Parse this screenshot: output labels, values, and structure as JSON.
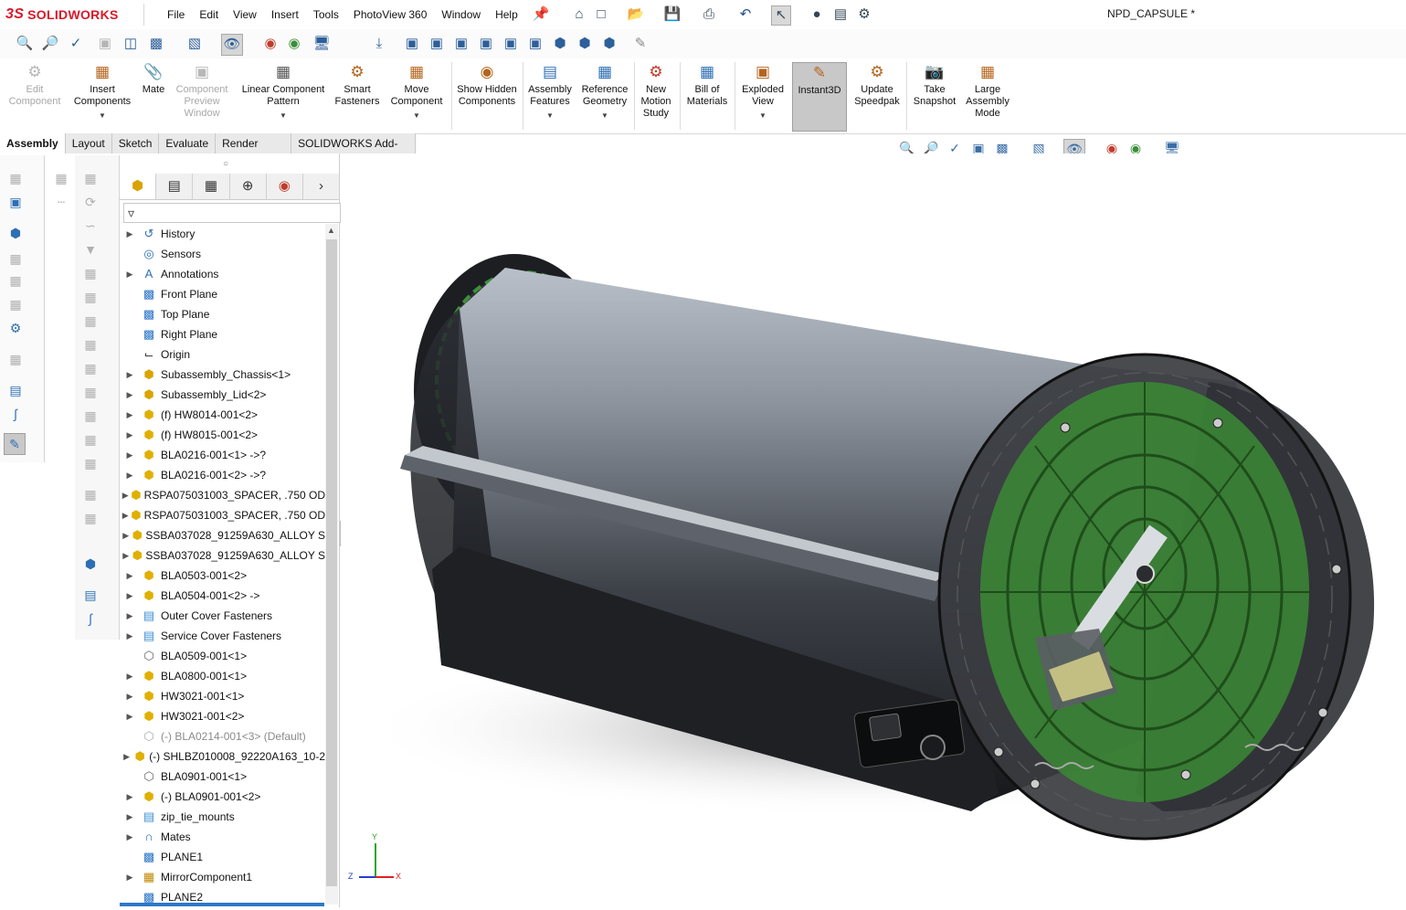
{
  "app": {
    "brand": "SOLIDWORKS",
    "brand_prefix": "3S",
    "document_title": "NPD_CAPSULE *"
  },
  "menu": [
    "File",
    "Edit",
    "View",
    "Insert",
    "Tools",
    "PhotoView 360",
    "Window",
    "Help"
  ],
  "command_manager": [
    {
      "label": "Edit Component",
      "icon": "edit-component-icon",
      "enabled": false
    },
    {
      "label": "Insert Components",
      "icon": "insert-components-icon",
      "enabled": true
    },
    {
      "label": "Mate",
      "icon": "mate-icon",
      "enabled": true
    },
    {
      "label": "Component Preview Window",
      "icon": "preview-window-icon",
      "enabled": false
    },
    {
      "label": "Linear Component Pattern",
      "icon": "linear-pattern-icon",
      "enabled": true
    },
    {
      "label": "Smart Fasteners",
      "icon": "smart-fasteners-icon",
      "enabled": true
    },
    {
      "label": "Move Component",
      "icon": "move-component-icon",
      "enabled": true
    },
    {
      "label": "Show Hidden Components",
      "icon": "show-hidden-icon",
      "enabled": true
    },
    {
      "label": "Assembly Features",
      "icon": "assembly-features-icon",
      "enabled": true
    },
    {
      "label": "Reference Geometry",
      "icon": "reference-geometry-icon",
      "enabled": true
    },
    {
      "label": "New Motion Study",
      "icon": "motion-study-icon",
      "enabled": true
    },
    {
      "label": "Bill of Materials",
      "icon": "bom-icon",
      "enabled": true
    },
    {
      "label": "Exploded View",
      "icon": "exploded-view-icon",
      "enabled": true
    },
    {
      "label": "Instant3D",
      "icon": "instant3d-icon",
      "enabled": true,
      "active": true
    },
    {
      "label": "Update Speedpak",
      "icon": "speedpak-icon",
      "enabled": true
    },
    {
      "label": "Take Snapshot",
      "icon": "snapshot-icon",
      "enabled": true
    },
    {
      "label": "Large Assembly Mode",
      "icon": "large-assembly-icon",
      "enabled": true
    }
  ],
  "tabs": [
    "Assembly",
    "Layout",
    "Sketch",
    "Evaluate",
    "Render Tools",
    "SOLIDWORKS Add-Ins"
  ],
  "active_tab": "Assembly",
  "tree": [
    {
      "label": "History",
      "icon": "history-icon",
      "expandable": true
    },
    {
      "label": "Sensors",
      "icon": "sensors-icon",
      "expandable": false
    },
    {
      "label": "Annotations",
      "icon": "annotations-icon",
      "expandable": true
    },
    {
      "label": "Front Plane",
      "icon": "plane-icon",
      "expandable": false
    },
    {
      "label": "Top Plane",
      "icon": "plane-icon",
      "expandable": false
    },
    {
      "label": "Right Plane",
      "icon": "plane-icon",
      "expandable": false
    },
    {
      "label": "Origin",
      "icon": "origin-icon",
      "expandable": false
    },
    {
      "label": "Subassembly_Chassis<1>",
      "icon": "assembly-icon",
      "expandable": true
    },
    {
      "label": "Subassembly_Lid<2>",
      "icon": "assembly-icon",
      "expandable": true
    },
    {
      "label": "(f) HW8014-001<2>",
      "icon": "part-icon",
      "expandable": true
    },
    {
      "label": "(f) HW8015-001<2>",
      "icon": "part-icon",
      "expandable": true
    },
    {
      "label": "BLA0216-001<1> ->?",
      "icon": "part-icon",
      "expandable": true
    },
    {
      "label": "BLA0216-001<2> ->?",
      "icon": "part-icon",
      "expandable": true
    },
    {
      "label": "RSPA075031003_SPACER, .750 OD",
      "icon": "part-icon",
      "expandable": true
    },
    {
      "label": "RSPA075031003_SPACER, .750 OD",
      "icon": "part-icon",
      "expandable": true
    },
    {
      "label": "SSBA037028_91259A630_ALLOY S",
      "icon": "part-icon",
      "expandable": true
    },
    {
      "label": "SSBA037028_91259A630_ALLOY S",
      "icon": "part-icon",
      "expandable": true
    },
    {
      "label": "BLA0503-001<2>",
      "icon": "part-icon",
      "expandable": true
    },
    {
      "label": "BLA0504-001<2> ->",
      "icon": "part-icon",
      "expandable": true
    },
    {
      "label": "Outer Cover Fasteners",
      "icon": "folder-icon",
      "expandable": true
    },
    {
      "label": "Service Cover Fasteners",
      "icon": "folder-icon",
      "expandable": true
    },
    {
      "label": "BLA0509-001<1>",
      "icon": "part-outline-icon",
      "expandable": false
    },
    {
      "label": "BLA0800-001<1>",
      "icon": "part-icon",
      "expandable": true
    },
    {
      "label": "HW3021-001<1>",
      "icon": "part-icon",
      "expandable": true
    },
    {
      "label": "HW3021-001<2>",
      "icon": "part-icon",
      "expandable": true
    },
    {
      "label": "(-) BLA0214-001<3> (Default)",
      "icon": "part-suppressed-icon",
      "expandable": false,
      "suppressed": true
    },
    {
      "label": "(-) SHLBZ010008_92220A163_10-2",
      "icon": "part-icon",
      "expandable": true
    },
    {
      "label": "BLA0901-001<1>",
      "icon": "part-outline-icon",
      "expandable": false
    },
    {
      "label": "(-) BLA0901-001<2>",
      "icon": "part-icon",
      "expandable": true
    },
    {
      "label": "zip_tie_mounts",
      "icon": "folder-icon",
      "expandable": true
    },
    {
      "label": "Mates",
      "icon": "mates-icon",
      "expandable": true
    },
    {
      "label": "PLANE1",
      "icon": "plane-icon",
      "expandable": false
    },
    {
      "label": "MirrorComponent1",
      "icon": "mirror-component-icon",
      "expandable": true
    },
    {
      "label": "PLANE2",
      "icon": "plane-icon",
      "expandable": false
    }
  ],
  "triad": {
    "x": "X",
    "y": "Y",
    "z": "Z"
  },
  "colors": {
    "accent": "#2e77c8",
    "brand": "#d7182a",
    "folder": "#3d8fd1",
    "part": "#f2c21b",
    "model_green": "#3f8f3a"
  }
}
